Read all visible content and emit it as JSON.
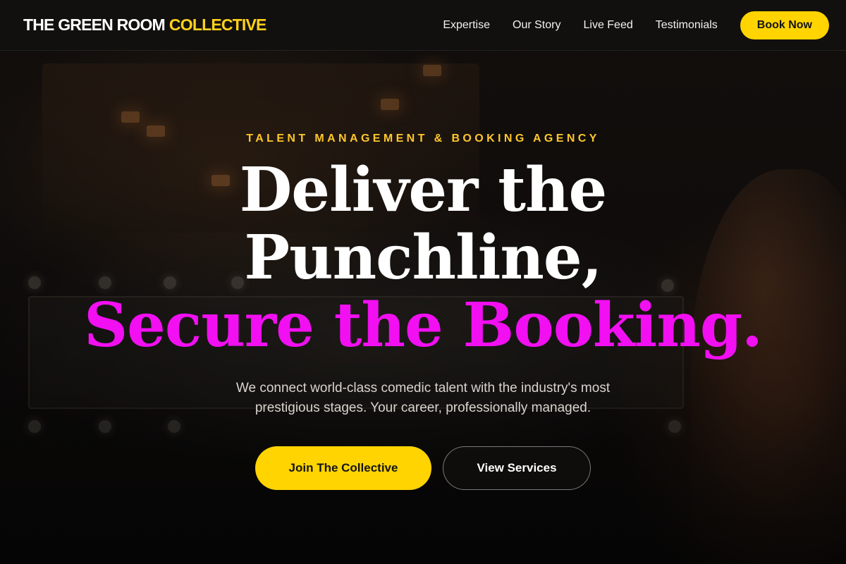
{
  "header": {
    "logo_primary": "THE GREEN ROOM",
    "logo_accent": "COLLECTIVE",
    "nav": [
      {
        "label": "Expertise"
      },
      {
        "label": "Our Story"
      },
      {
        "label": "Live Feed"
      },
      {
        "label": "Testimonials"
      }
    ],
    "cta_label": "Book Now"
  },
  "hero": {
    "eyebrow": "TALENT MANAGEMENT & BOOKING AGENCY",
    "headline_line1": "Deliver the",
    "headline_line2": "Punchline,",
    "headline_line3": "Secure the Booking.",
    "subtitle": "We connect world-class comedic talent with the industry's most prestigious stages. Your career, professionally managed.",
    "primary_cta": "Join The Collective",
    "secondary_cta": "View Services"
  },
  "colors": {
    "accent_yellow": "#ffd400",
    "accent_magenta": "#f20ff2",
    "background": "#0e0c0b"
  }
}
